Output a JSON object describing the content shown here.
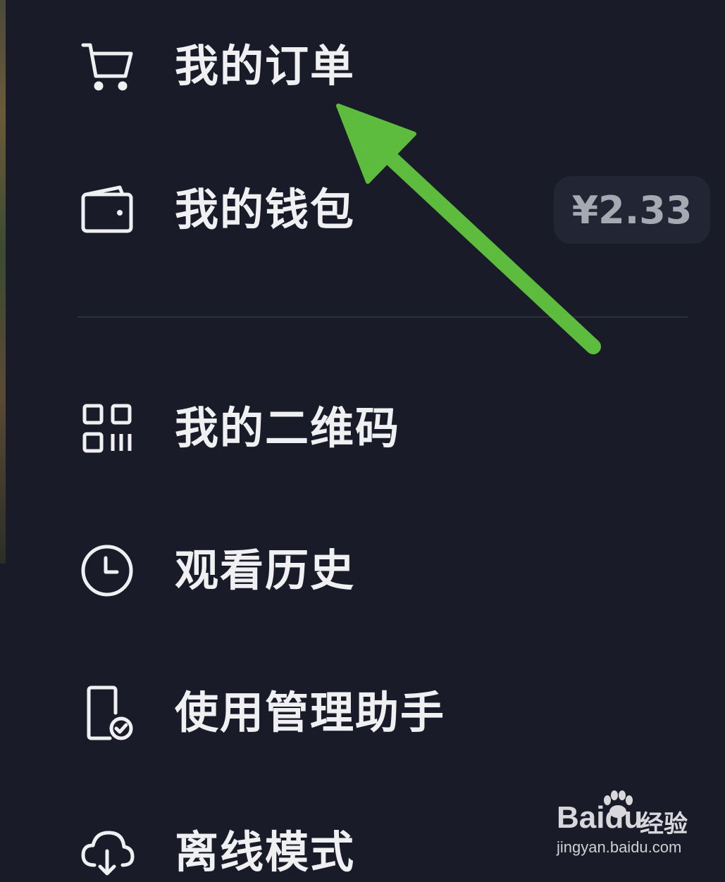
{
  "menu": {
    "items": [
      {
        "label": "我的订单",
        "icon": "cart-icon"
      },
      {
        "label": "我的钱包",
        "icon": "wallet-icon",
        "badge": "¥2.33"
      },
      {
        "label": "我的二维码",
        "icon": "qr-code-icon"
      },
      {
        "label": "观看历史",
        "icon": "clock-icon"
      },
      {
        "label": "使用管理助手",
        "icon": "phone-check-icon"
      },
      {
        "label": "离线模式",
        "icon": "cloud-download-icon"
      }
    ]
  },
  "watermark": {
    "brand": "Bai",
    "brand_du": "du",
    "brand_cn": "经验",
    "url": "jingyan.baidu.com"
  },
  "colors": {
    "background": "#191b29",
    "text": "#f0f0f2",
    "arrow": "#5dbb3d"
  }
}
